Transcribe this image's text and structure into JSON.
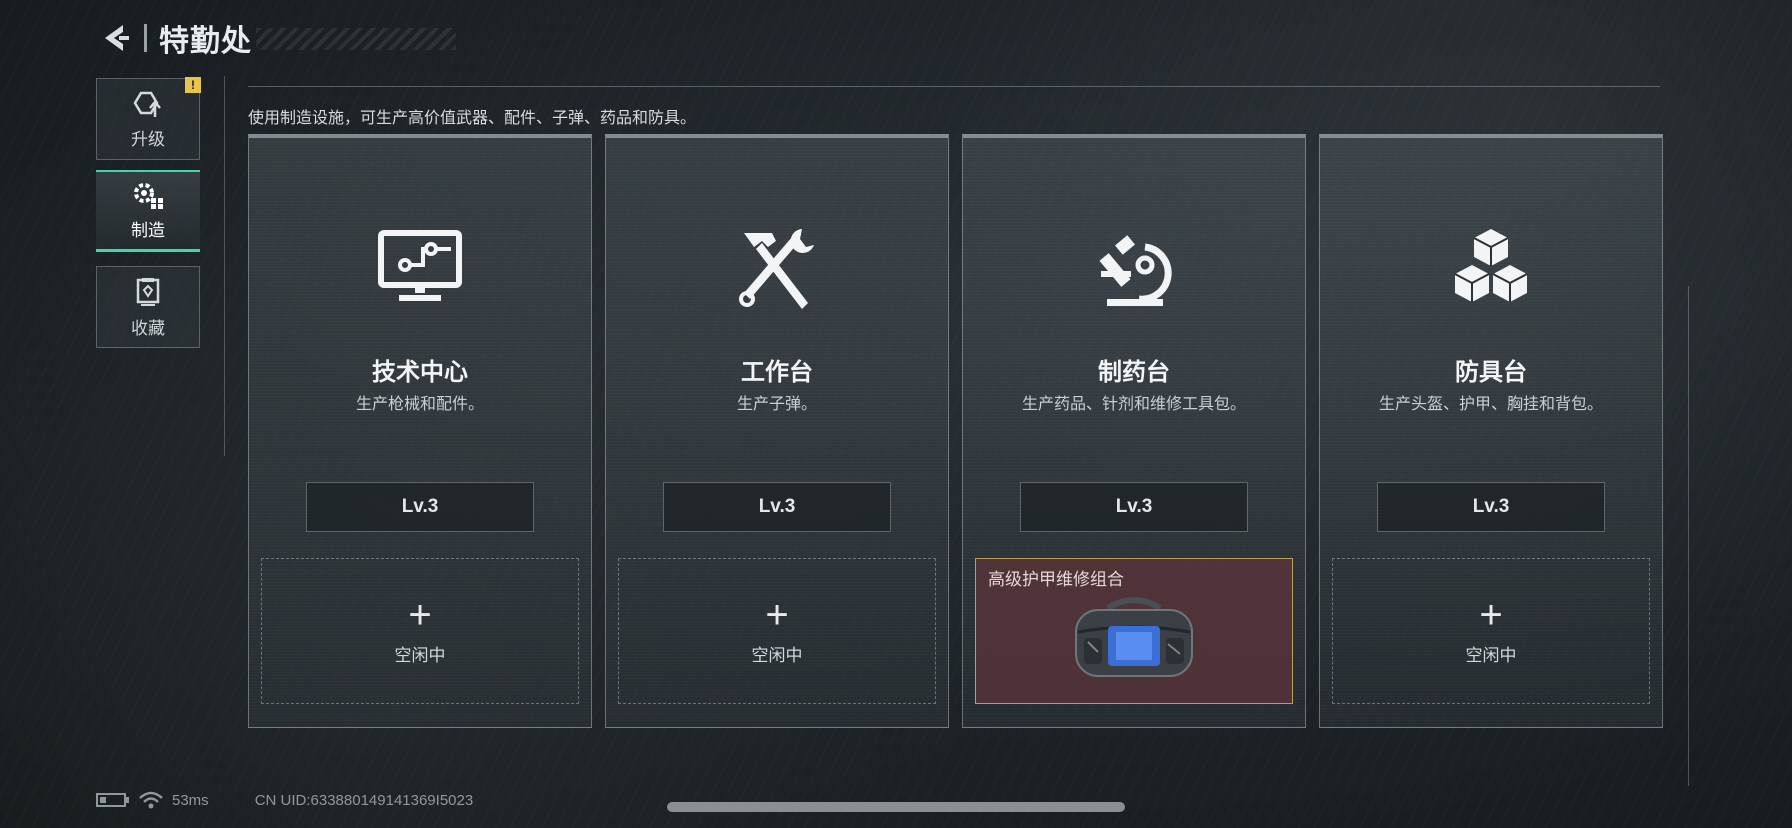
{
  "header": {
    "title": "特勤处",
    "back_icon": "back-arrow-icon"
  },
  "nav": [
    {
      "label": "升级",
      "icon": "upgrade-icon",
      "badge": "!",
      "active": false
    },
    {
      "label": "制造",
      "icon": "gears-icon",
      "active": true
    },
    {
      "label": "收藏",
      "icon": "collection-icon",
      "active": false
    }
  ],
  "description": "使用制造设施，可生产高价值武器、配件、子弹、药品和防具。",
  "stations": [
    {
      "name": "技术中心",
      "desc": "生产枪械和配件。",
      "level": "Lv.3",
      "icon": "computer-icon",
      "slot": {
        "status": "idle",
        "label": "空闲中"
      }
    },
    {
      "name": "工作台",
      "desc": "生产子弹。",
      "level": "Lv.3",
      "icon": "hammer-wrench-icon",
      "slot": {
        "status": "idle",
        "label": "空闲中"
      }
    },
    {
      "name": "制药台",
      "desc": "生产药品、针剂和维修工具包。",
      "level": "Lv.3",
      "icon": "microscope-icon",
      "slot": {
        "status": "busy",
        "label": "高级护甲维修组合"
      }
    },
    {
      "name": "防具台",
      "desc": "生产头盔、护甲、胸挂和背包。",
      "level": "Lv.3",
      "icon": "boxes-icon",
      "slot": {
        "status": "idle",
        "label": "空闲中"
      }
    }
  ],
  "footer": {
    "ping": "53ms",
    "uid": "CN UID:633880149141369I5023"
  },
  "colors": {
    "accent": "#3fd6b0",
    "badge": "#e9c44a",
    "busy_bg": "#5c343a",
    "busy_border": "#b9a15a"
  }
}
